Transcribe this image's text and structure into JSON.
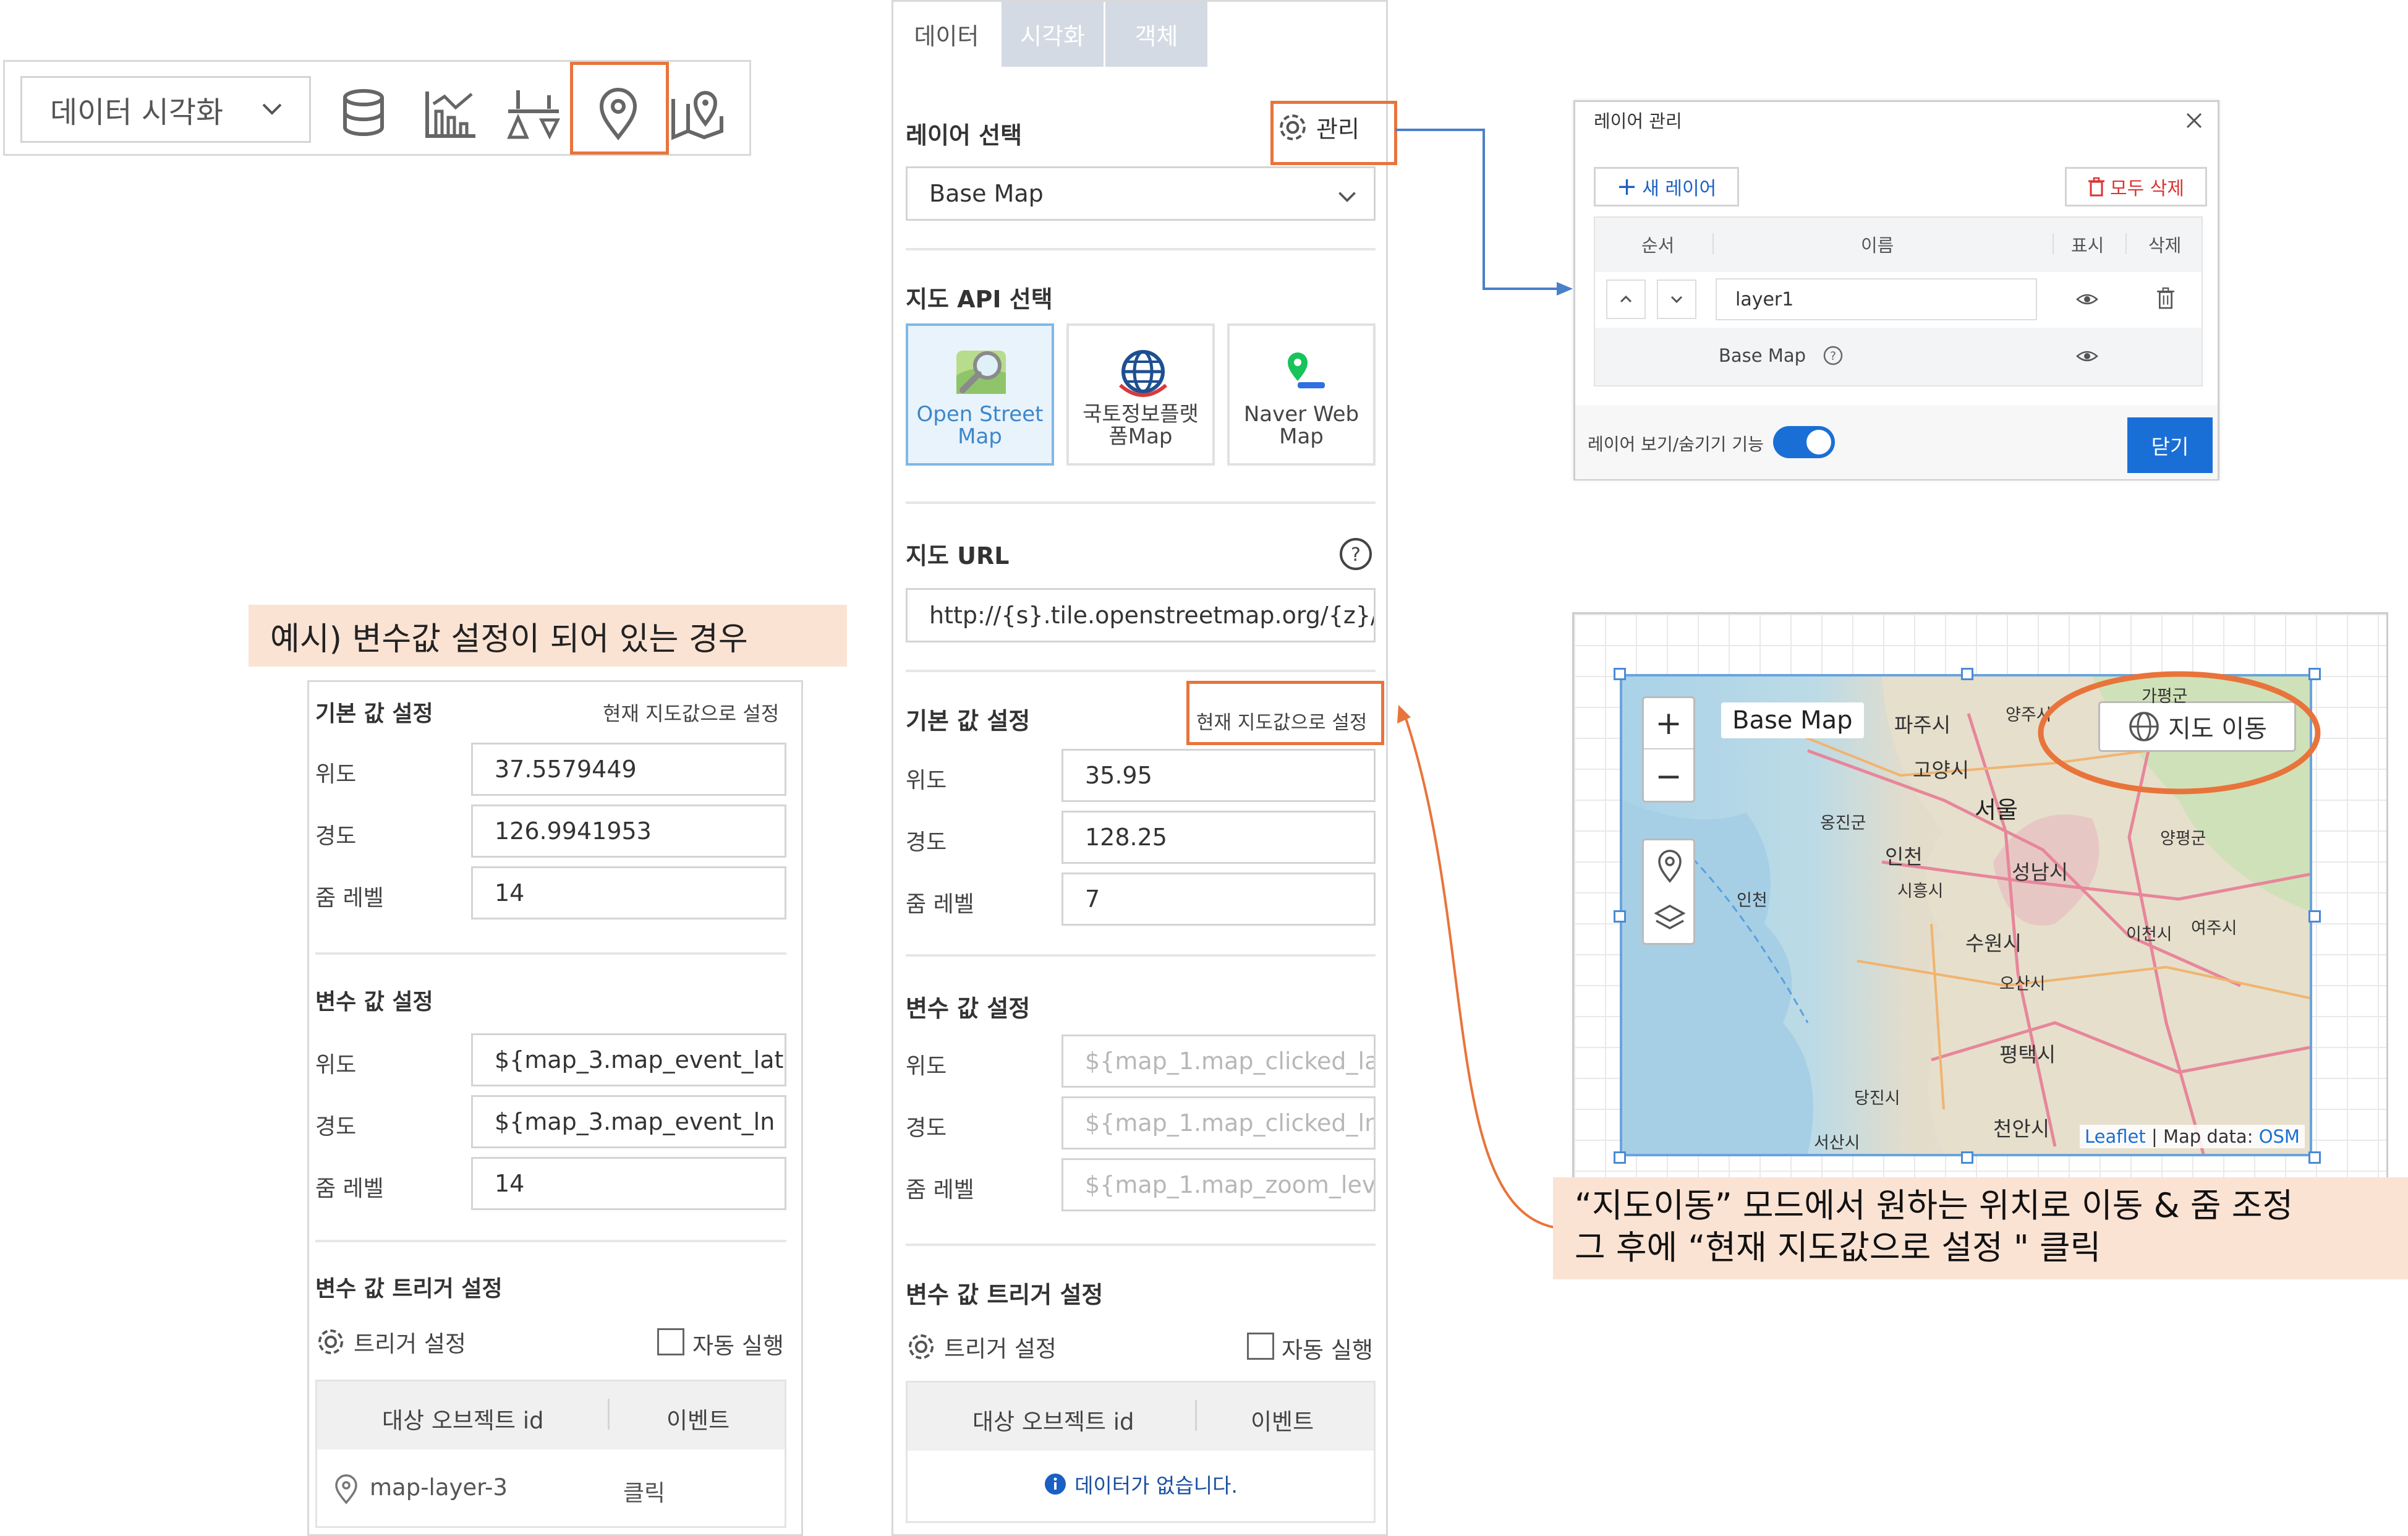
{
  "toolbar": {
    "dropdown_label": "데이터 시각화",
    "icons": [
      "database-icon",
      "bar-chart-icon",
      "filter-sort-icon",
      "map-pin-icon",
      "map-icon"
    ],
    "highlighted": "map-pin-icon"
  },
  "panel": {
    "tabs": [
      "데이터",
      "시각화",
      "객체"
    ],
    "active_tab": "데이터",
    "layer_select": {
      "title": "레이어 선택",
      "manage_label": "관리",
      "value": "Base Map"
    },
    "map_api": {
      "title": "지도 API 선택",
      "options": [
        {
          "line1": "Open Street",
          "line2": "Map",
          "selected": true
        },
        {
          "line1": "국토정보플랫",
          "line2": "폼Map",
          "selected": false
        },
        {
          "line1": "Naver Web",
          "line2": "Map",
          "selected": false
        }
      ]
    },
    "map_url": {
      "title": "지도 URL",
      "value": "http://{s}.tile.openstreetmap.org/{z}/{x"
    },
    "defaults": {
      "title": "기본 값 설정",
      "set_current_label": "현재 지도값으로 설정",
      "lat_label": "위도",
      "lat": "35.95",
      "lng_label": "경도",
      "lng": "128.25",
      "zoom_label": "줌 레벨",
      "zoom": "7"
    },
    "variables": {
      "title": "변수 값 설정",
      "lat_label": "위도",
      "lat_ph": "${map_1.map_clicked_la",
      "lng_label": "경도",
      "lng_ph": "${map_1.map_clicked_ln",
      "zoom_label": "줌 레벨",
      "zoom_ph": "${map_1.map_zoom_lev"
    },
    "trigger": {
      "title": "변수 값 트리거 설정",
      "settings_label": "트리거 설정",
      "auto_label": "자동 실행",
      "col_object": "대상 오브젝트 id",
      "col_event": "이벤트",
      "empty": "데이터가 없습니다."
    }
  },
  "example": {
    "label": "예시) 변수값 설정이 되어 있는 경우",
    "defaults": {
      "title": "기본 값 설정",
      "set_current_label": "현재 지도값으로 설정",
      "lat_label": "위도",
      "lat": "37.5579449",
      "lng_label": "경도",
      "lng": "126.9941953",
      "zoom_label": "줌 레벨",
      "zoom": "14"
    },
    "variables": {
      "title": "변수 값 설정",
      "lat_label": "위도",
      "lat": "${map_3.map_event_lat",
      "lng_label": "경도",
      "lng": "${map_3.map_event_ln",
      "zoom_label": "줌 레벨",
      "zoom": "14"
    },
    "trigger": {
      "title": "변수 값 트리거 설정",
      "settings_label": "트리거 설정",
      "auto_label": "자동 실행",
      "col_object": "대상 오브젝트 id",
      "col_event": "이벤트",
      "row_object": "map-layer-3",
      "row_event": "클릭"
    }
  },
  "dialog": {
    "title": "레이어 관리",
    "new_layer": "새 레이어",
    "delete_all": "모두 삭제",
    "cols": {
      "order": "순서",
      "name": "이름",
      "show": "표시",
      "delete": "삭제"
    },
    "layer_name": "layer1",
    "base_map": "Base Map",
    "toggle_label": "레이어 보기/숨기기 기능",
    "toggle_on": true,
    "close": "닫기"
  },
  "map_widget": {
    "base_map_label": "Base Map",
    "move_button": "지도 이동",
    "places": [
      "파주시",
      "양주시",
      "가평군",
      "고양시",
      "서울",
      "옹진군",
      "인천",
      "시흥시",
      "성남시",
      "양평군",
      "인천",
      "수원시",
      "이천시",
      "여주시",
      "오산시",
      "평택시",
      "당진시",
      "서산시",
      "천안시"
    ],
    "attribution_leaflet": "Leaflet",
    "attribution_rest": " | Map data: ",
    "attribution_osm": "OSM"
  },
  "note": {
    "line1": "“지도이동” 모드에서 원하는 위치로 이동 & 줌 조정",
    "line2": "그 후에 “현재 지도값으로 설정 \"  클릭"
  },
  "colors": {
    "accent_orange": "#e8743b",
    "primary_blue": "#1a6fd6",
    "note_bg": "#fbe3d4"
  }
}
